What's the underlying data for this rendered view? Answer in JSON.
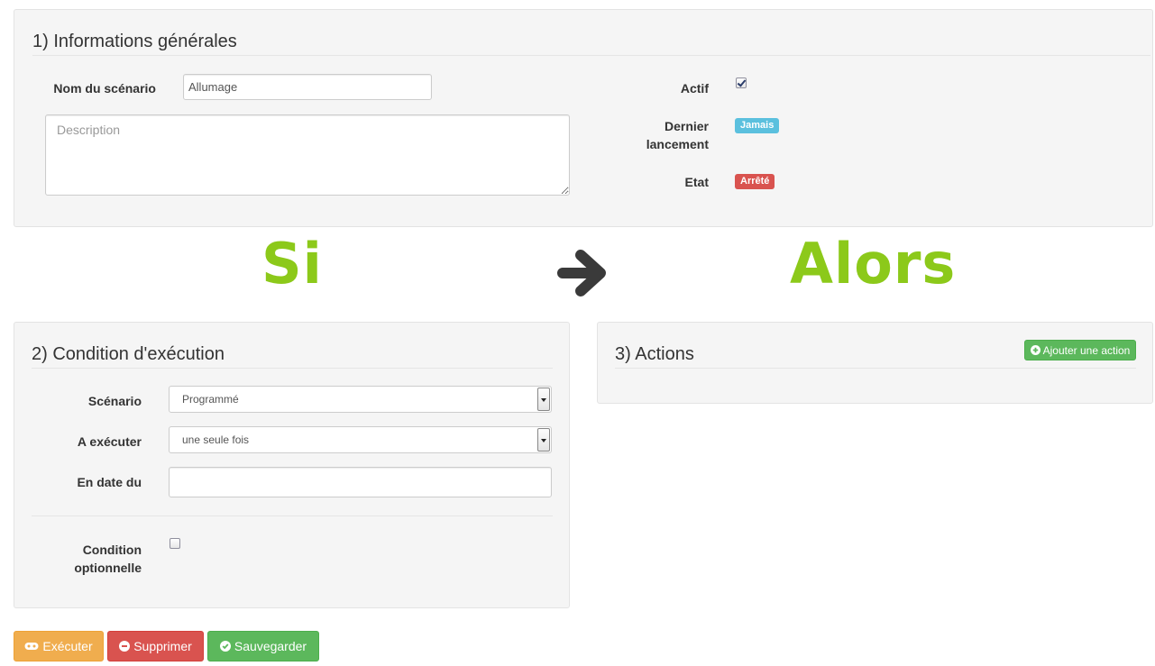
{
  "section1": {
    "title": "1) Informations générales",
    "name_label": "Nom du scénario",
    "name_value": "Allumage",
    "description_placeholder": "Description",
    "actif_label": "Actif",
    "actif_checked": true,
    "dernier_label_line1": "Dernier",
    "dernier_label_line2": "lancement",
    "dernier_badge": "Jamais",
    "etat_label": "Etat",
    "etat_badge": "Arrêté"
  },
  "flow": {
    "if_text": "Si",
    "then_text": "Alors",
    "arrow_icon": "arrow-right-icon"
  },
  "section2": {
    "title": "2) Condition d'exécution",
    "scenario_label": "Scénario",
    "scenario_value": "Programmé",
    "execute_label": "A exécuter",
    "execute_value": "une seule fois",
    "date_label": "En date du",
    "date_value": "",
    "optional_label_line1": "Condition",
    "optional_label_line2": "optionnelle",
    "optional_checked": false
  },
  "section3": {
    "title": "3) Actions",
    "add_action_label": "Ajouter une action"
  },
  "footer": {
    "execute_label": "Exécuter",
    "delete_label": "Supprimer",
    "save_label": "Sauvegarder"
  },
  "colors": {
    "badge_info": "#5bc0de",
    "badge_danger": "#d9534f",
    "accent_green": "#8cc91a"
  }
}
